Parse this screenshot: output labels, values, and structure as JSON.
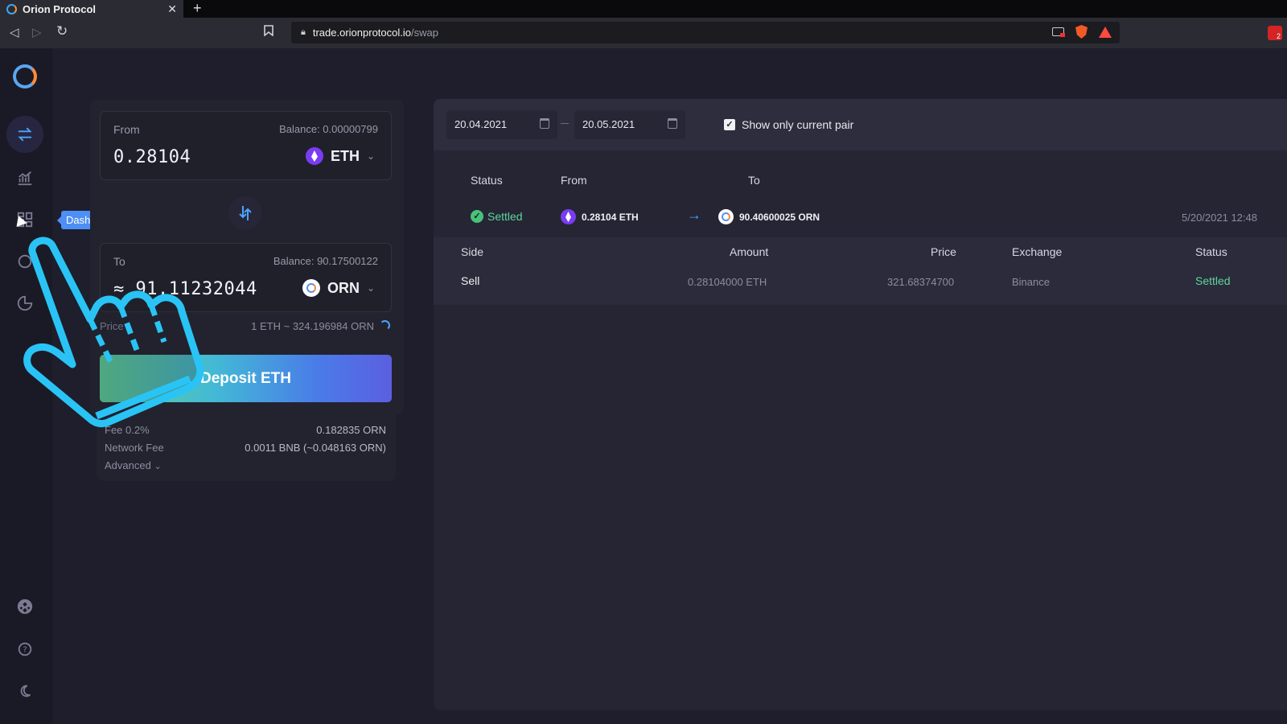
{
  "browser": {
    "tab_title": "Orion Protocol",
    "tab_close": "✕",
    "new_tab": "+",
    "url_host": "trade.orionprotocol.io",
    "url_path": "/swap",
    "ext_badge": "2"
  },
  "sidebar": {
    "tooltip": "Dashboard"
  },
  "swap": {
    "from": {
      "label": "From",
      "balance": "Balance: 0.00000799",
      "amount": "0.28104",
      "token": "ETH"
    },
    "to": {
      "label": "To",
      "balance": "Balance: 90.17500122",
      "amount": "≈ 91.11232044",
      "token": "ORN"
    },
    "price_label": "Price",
    "price_value": "1 ETH ~ 324.196984 ORN",
    "deposit_button": "Deposit ETH",
    "fee_label": "Fee 0.2%",
    "fee_value": "0.182835 ORN",
    "network_fee_label": "Network Fee",
    "network_fee_value": "0.0011 BNB (~0.048163 ORN)",
    "advanced_label": "Advanced"
  },
  "history": {
    "date_from": "20.04.2021",
    "date_to": "20.05.2021",
    "checkbox_label": "Show only current pair",
    "checkbox_checked": true,
    "headers": {
      "status": "Status",
      "from": "From",
      "to": "To"
    },
    "trade": {
      "status": "Settled",
      "from": "0.28104 ETH",
      "to": "90.40600025 ORN",
      "date": "5/20/2021 12:48"
    },
    "sub_headers": {
      "side": "Side",
      "amount": "Amount",
      "price": "Price",
      "exchange": "Exchange",
      "status": "Status"
    },
    "sub_row": {
      "side": "Sell",
      "amount": "0.28104000 ETH",
      "price": "321.68374700",
      "exchange": "Binance",
      "status": "Settled"
    }
  },
  "colors": {
    "accent_blue": "#4da3ff",
    "settled_green": "#5fd69a",
    "tooltip_blue": "#4d8ff5"
  }
}
